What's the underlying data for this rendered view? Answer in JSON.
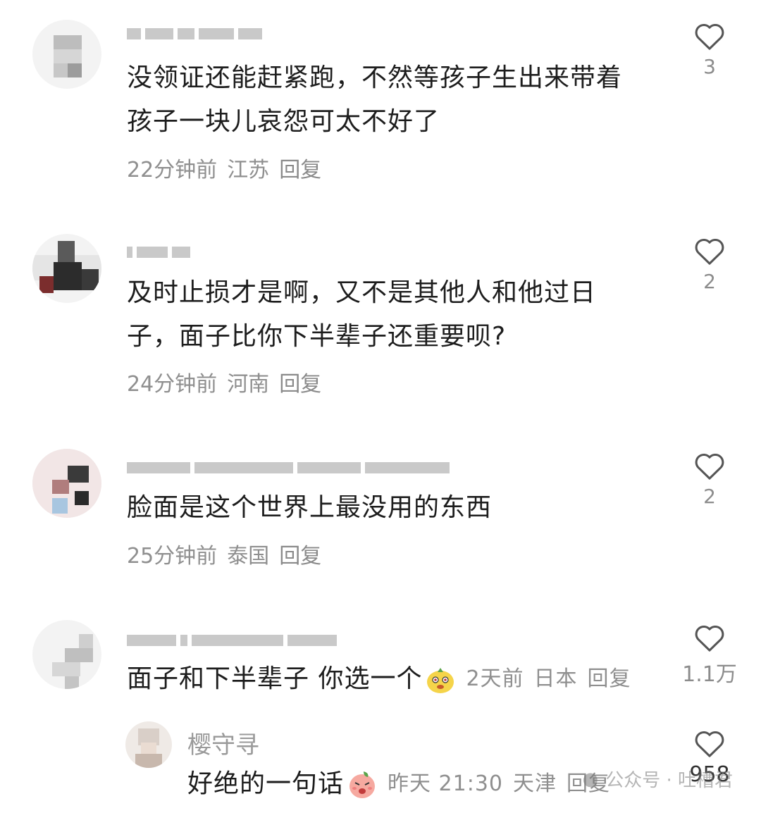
{
  "comments": [
    {
      "text_line1": "没领证还能赶紧跑，不然等孩子生出来带着",
      "text_line2": "孩子一块儿哀怨可太不好了",
      "time": "22分钟前",
      "location": "江苏",
      "reply": "回复",
      "likes": "3"
    },
    {
      "text_line1": "及时止损才是啊，又不是其他人和他过日",
      "text_line2": "子，面子比你下半辈子还重要呗?",
      "time": "24分钟前",
      "location": "河南",
      "reply": "回复",
      "likes": "2"
    },
    {
      "text_line1": "脸面是这个世界上最没用的东西",
      "time": "25分钟前",
      "location": "泰国",
      "reply": "回复",
      "likes": "2"
    },
    {
      "text_line1": "面子和下半辈子 你选一个",
      "time": "2天前",
      "location": "日本",
      "reply": "回复",
      "likes": "1.1万"
    }
  ],
  "sub_reply": {
    "username": "樱守寻",
    "text": "好绝的一句话",
    "time": "昨天 21:30",
    "location": "天津",
    "reply": "回复",
    "likes": "958"
  },
  "watermark": {
    "text": "公众号 · 吐槽君"
  }
}
